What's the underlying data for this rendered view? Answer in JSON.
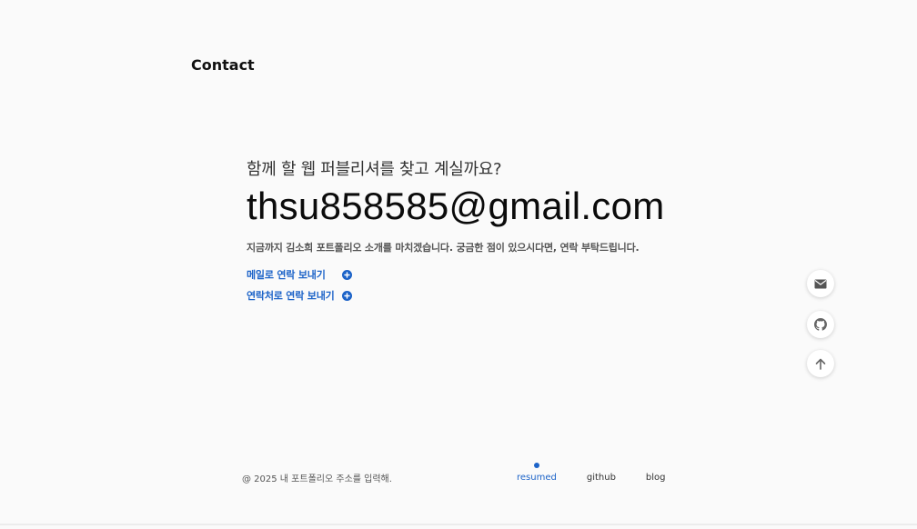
{
  "section": {
    "title": "Contact"
  },
  "contact": {
    "question": "함께 할 웹 퍼블리셔를 찾고 계실까요?",
    "email": "thsu858585@gmail.com",
    "description": "지금까지 김소희 포트폴리오 소개를 마치겠습니다. 궁금한 점이 있으시다면, 연락 부탁드립니다.",
    "links": [
      {
        "label": "메일로 연락 보내기"
      },
      {
        "label": "연락처로 연락 보내기"
      }
    ]
  },
  "side_buttons": {
    "icons": [
      "mail-icon",
      "github-icon",
      "arrow-up-icon"
    ]
  },
  "footer": {
    "copyright": "@ 2025 내 포트폴리오 주소를 입력해.",
    "nav": [
      {
        "label": "resumed",
        "active": true
      },
      {
        "label": "github"
      },
      {
        "label": "blog"
      }
    ]
  },
  "colors": {
    "accent": "#1c63c8",
    "background": "#fafafa",
    "text": "#111111"
  }
}
